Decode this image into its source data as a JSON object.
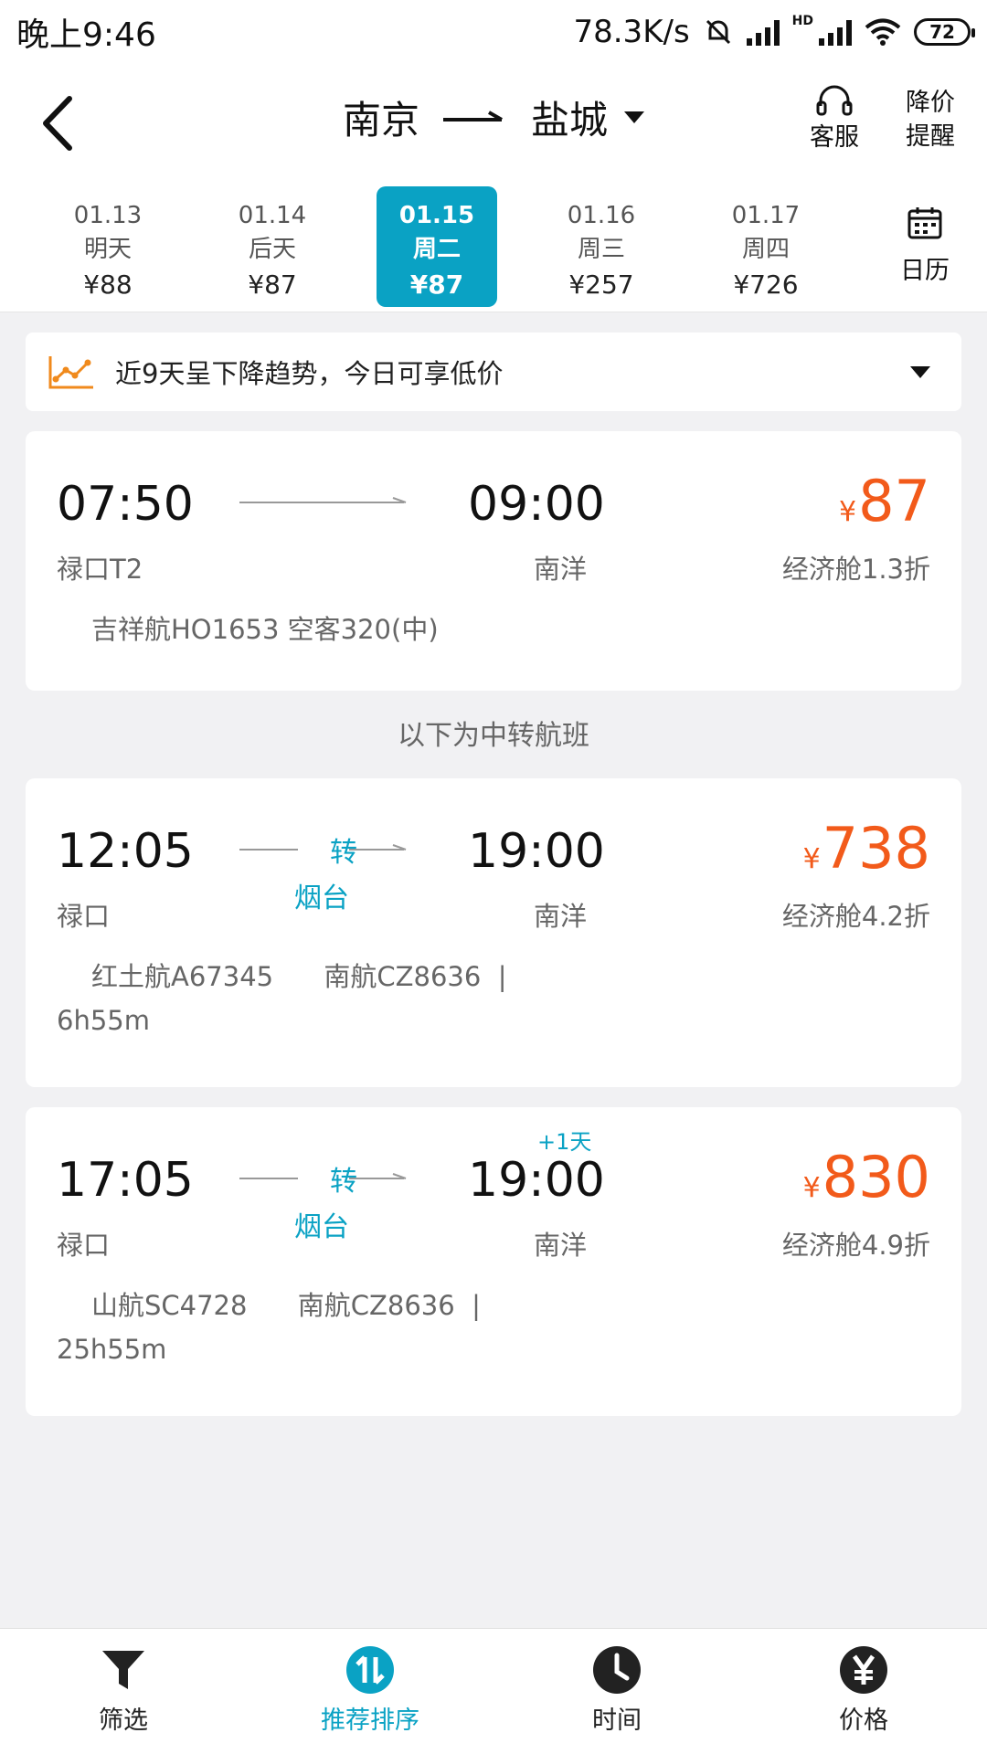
{
  "status": {
    "time": "晚上9:46",
    "speed": "78.3K/s",
    "battery": "72"
  },
  "header": {
    "origin": "南京",
    "destination": "盐城",
    "service_label": "客服",
    "alert_line1": "降价",
    "alert_line2": "提醒"
  },
  "dates": [
    {
      "date": "01.13",
      "day": "明天",
      "price": "¥88"
    },
    {
      "date": "01.14",
      "day": "后天",
      "price": "¥87"
    },
    {
      "date": "01.15",
      "day": "周二",
      "price": "¥87"
    },
    {
      "date": "01.16",
      "day": "周三",
      "price": "¥257"
    },
    {
      "date": "01.17",
      "day": "周四",
      "price": "¥726"
    }
  ],
  "calendar_label": "日历",
  "trend_text": "近9天呈下降趋势，今日可享低价",
  "divider_text": "以下为中转航班",
  "flights": [
    {
      "dep": "07:50",
      "arr": "09:00",
      "dep_airport": "禄口T2",
      "arr_airport": "南洋",
      "yen": "¥",
      "price": "87",
      "cabin": "经济舱1.3折",
      "info": "吉祥航HO1653  空客320(中)"
    },
    {
      "dep": "12:05",
      "arr": "19:00",
      "dep_airport": "禄口",
      "arr_airport": "南洋",
      "yen": "¥",
      "price": "738",
      "cabin": "经济舱4.2折",
      "transfer": "转",
      "transfer_city": "烟台",
      "info": "红土航A67345      南航CZ8636  |",
      "duration": "6h55m"
    },
    {
      "dep": "17:05",
      "arr": "19:00",
      "plus_day": "+1天",
      "dep_airport": "禄口",
      "arr_airport": "南洋",
      "yen": "¥",
      "price": "830",
      "cabin": "经济舱4.9折",
      "transfer": "转",
      "transfer_city": "烟台",
      "info": "山航SC4728      南航CZ8636  |",
      "duration": "25h55m"
    }
  ],
  "tabs": [
    {
      "label": "筛选"
    },
    {
      "label": "推荐排序"
    },
    {
      "label": "时间"
    },
    {
      "label": "价格"
    }
  ],
  "colors": {
    "accent": "#0aa2c4",
    "price": "#f25a1a"
  }
}
